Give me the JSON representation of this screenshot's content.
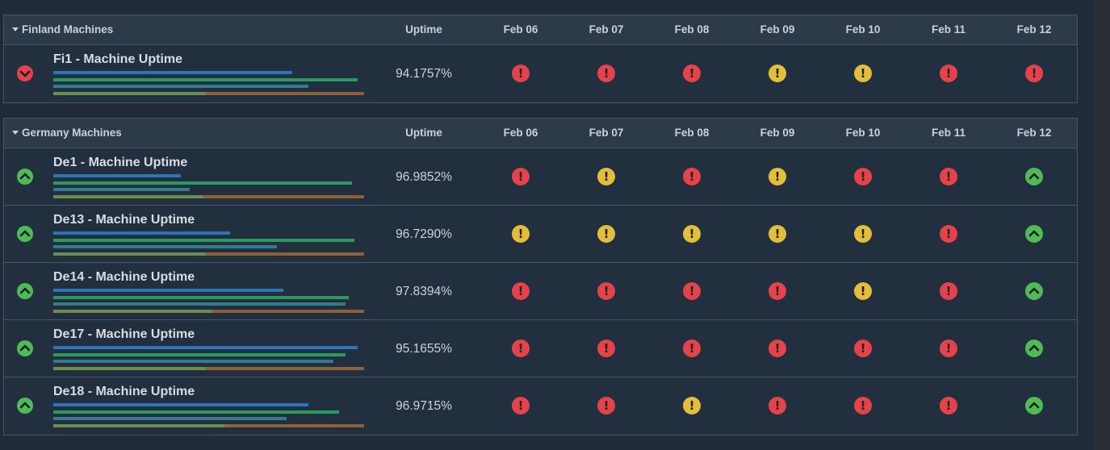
{
  "colors": {
    "red": "#e5434b",
    "yellow": "#e2be3c",
    "green": "#4fbb56",
    "bar_blue": "#2f74b8",
    "bar_green": "#2c9a5e",
    "bar_teal": "#337a8c",
    "bar_olive": "#6d8e4e",
    "bar_orange": "#8c6038"
  },
  "columns": {
    "uptime": "Uptime",
    "days": [
      "Feb 06",
      "Feb 07",
      "Feb 08",
      "Feb 09",
      "Feb 10",
      "Feb 11",
      "Feb 12"
    ]
  },
  "groups": [
    {
      "title": "Finland Machines",
      "rows": [
        {
          "name": "Fi1 - Machine Uptime",
          "uptime": "94.1757%",
          "trend": "down",
          "bars": [
            0.77,
            0.98,
            0.82,
            0.49
          ],
          "days": [
            "error",
            "error",
            "error",
            "warning",
            "warning",
            "error",
            "error"
          ]
        }
      ]
    },
    {
      "title": "Germany Machines",
      "rows": [
        {
          "name": "De1 - Machine Uptime",
          "uptime": "96.9852%",
          "trend": "up",
          "bars": [
            0.41,
            0.96,
            0.44,
            0.48
          ],
          "days": [
            "error",
            "warning",
            "error",
            "warning",
            "error",
            "error",
            "ok"
          ]
        },
        {
          "name": "De13 - Machine Uptime",
          "uptime": "96.7290%",
          "trend": "up",
          "bars": [
            0.57,
            0.97,
            0.72,
            0.49
          ],
          "days": [
            "warning",
            "warning",
            "warning",
            "warning",
            "warning",
            "error",
            "ok"
          ]
        },
        {
          "name": "De14 - Machine Uptime",
          "uptime": "97.8394%",
          "trend": "up",
          "bars": [
            0.74,
            0.95,
            0.94,
            0.51
          ],
          "days": [
            "error",
            "error",
            "error",
            "error",
            "warning",
            "error",
            "ok"
          ]
        },
        {
          "name": "De17 - Machine Uptime",
          "uptime": "95.1655%",
          "trend": "up",
          "bars": [
            0.98,
            0.94,
            0.9,
            0.49
          ],
          "days": [
            "error",
            "error",
            "error",
            "error",
            "error",
            "error",
            "ok"
          ]
        },
        {
          "name": "De18 - Machine Uptime",
          "uptime": "96.9715%",
          "trend": "up",
          "bars": [
            0.82,
            0.92,
            0.75,
            0.55
          ],
          "days": [
            "error",
            "error",
            "warning",
            "error",
            "error",
            "error",
            "ok"
          ]
        }
      ]
    }
  ]
}
